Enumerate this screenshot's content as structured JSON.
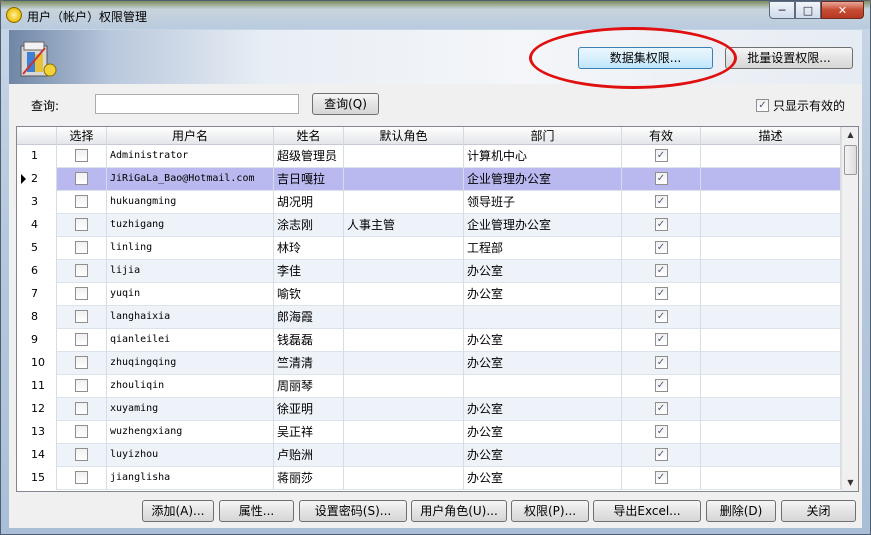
{
  "window": {
    "title": "用户（帐户）权限管理",
    "minimize": "─",
    "maximize": "□",
    "close": "✕"
  },
  "toolbar": {
    "dataset_permission_label": "数据集权限...",
    "batch_permission_label": "批量设置权限..."
  },
  "search": {
    "label": "查询:",
    "value": "",
    "placeholder": "",
    "button_label": "查询(Q)"
  },
  "filter": {
    "only_valid_label": "只显示有效的",
    "only_valid_checked": true
  },
  "grid": {
    "columns": [
      "选择",
      "用户名",
      "姓名",
      "默认角色",
      "部门",
      "有效",
      "描述"
    ],
    "selected_row": 2,
    "rows": [
      {
        "no": "1",
        "username": "Administrator",
        "name": "超级管理员",
        "role": "",
        "dept": "计算机中心",
        "valid": true,
        "desc": ""
      },
      {
        "no": "2",
        "username": "JiRiGaLa_Bao@Hotmail.com",
        "name": "吉日嘎拉",
        "role": "",
        "dept": "企业管理办公室",
        "valid": true,
        "desc": ""
      },
      {
        "no": "3",
        "username": "hukuangming",
        "name": "胡况明",
        "role": "",
        "dept": "领导班子",
        "valid": true,
        "desc": ""
      },
      {
        "no": "4",
        "username": "tuzhigang",
        "name": "涂志刚",
        "role": "人事主管",
        "dept": "企业管理办公室",
        "valid": true,
        "desc": ""
      },
      {
        "no": "5",
        "username": "linling",
        "name": "林玲",
        "role": "",
        "dept": "工程部",
        "valid": true,
        "desc": ""
      },
      {
        "no": "6",
        "username": "lijia",
        "name": "李佳",
        "role": "",
        "dept": "办公室",
        "valid": true,
        "desc": ""
      },
      {
        "no": "7",
        "username": "yuqin",
        "name": "喻钦",
        "role": "",
        "dept": "办公室",
        "valid": true,
        "desc": ""
      },
      {
        "no": "8",
        "username": "langhaixia",
        "name": "郎海霞",
        "role": "",
        "dept": "",
        "valid": true,
        "desc": ""
      },
      {
        "no": "9",
        "username": "qianleilei",
        "name": "钱磊磊",
        "role": "",
        "dept": "办公室",
        "valid": true,
        "desc": ""
      },
      {
        "no": "10",
        "username": "zhuqingqing",
        "name": "竺清清",
        "role": "",
        "dept": "办公室",
        "valid": true,
        "desc": ""
      },
      {
        "no": "11",
        "username": "zhouliqin",
        "name": "周丽琴",
        "role": "",
        "dept": "",
        "valid": true,
        "desc": ""
      },
      {
        "no": "12",
        "username": "xuyaming",
        "name": "徐亚明",
        "role": "",
        "dept": "办公室",
        "valid": true,
        "desc": ""
      },
      {
        "no": "13",
        "username": "wuzhengxiang",
        "name": "吴正祥",
        "role": "",
        "dept": "办公室",
        "valid": true,
        "desc": ""
      },
      {
        "no": "14",
        "username": "luyizhou",
        "name": "卢贻洲",
        "role": "",
        "dept": "办公室",
        "valid": true,
        "desc": ""
      },
      {
        "no": "15",
        "username": "jianglisha",
        "name": "蒋丽莎",
        "role": "",
        "dept": "办公室",
        "valid": true,
        "desc": ""
      }
    ]
  },
  "actions": {
    "add": "添加(A)...",
    "properties": "属性...",
    "set_password": "设置密码(S)...",
    "user_roles": "用户角色(U)...",
    "permissions": "权限(P)...",
    "export_excel": "导出Excel...",
    "delete": "删除(D)",
    "close": "关闭"
  },
  "colors": {
    "selected_row": "#b9b9f0",
    "alt_row": "#eef3fa",
    "annotation_ring": "#e01010"
  }
}
